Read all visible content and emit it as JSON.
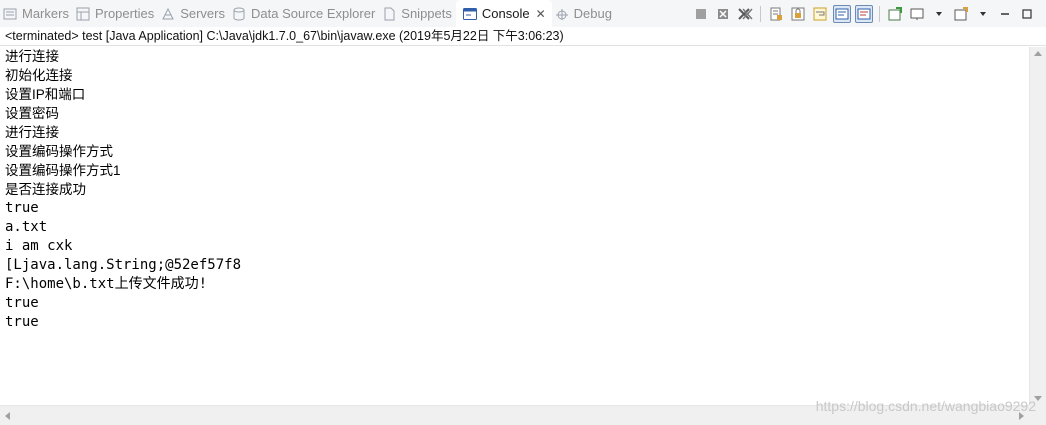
{
  "tabs": [
    {
      "label": "Markers",
      "icon": "markers-icon",
      "active": false
    },
    {
      "label": "Properties",
      "icon": "properties-icon",
      "active": false
    },
    {
      "label": "Servers",
      "icon": "servers-icon",
      "active": false
    },
    {
      "label": "Data Source Explorer",
      "icon": "data-source-icon",
      "active": false
    },
    {
      "label": "Snippets",
      "icon": "snippets-icon",
      "active": false
    },
    {
      "label": "Console",
      "icon": "console-icon",
      "active": true,
      "close": "✕"
    },
    {
      "label": "Debug",
      "icon": "debug-icon",
      "active": false
    }
  ],
  "toolbar": {
    "icons": [
      "terminate-icon",
      "remove-launch-icon",
      "remove-all-terminated-icon",
      "clear-console-icon",
      "scroll-lock-icon",
      "word-wrap-icon",
      "show-stdout-icon",
      "show-stderr-icon",
      "pin-console-icon",
      "display-console-icon",
      "open-console-icon",
      "minimize-icon",
      "maximize-icon"
    ]
  },
  "status": "<terminated> test [Java Application] C:\\Java\\jdk1.7.0_67\\bin\\javaw.exe (2019年5月22日 下午3:06:23)",
  "console_lines": [
    "进行连接",
    "初始化连接",
    "设置IP和端口",
    "设置密码",
    "进行连接",
    "设置编码操作方式",
    "设置编码操作方式1",
    "是否连接成功",
    "true",
    "a.txt",
    "i am cxk",
    "[Ljava.lang.String;@52ef57f8",
    "F:\\home\\b.txt上传文件成功!",
    "true",
    "true"
  ],
  "watermark": "https://blog.csdn.net/wangbiao9292",
  "colors": {
    "tab_bar_bg": "#f5f6f8",
    "console_bg": "#ffffff",
    "text": "#000000",
    "inactive_tab_text": "#8e8e8e"
  }
}
